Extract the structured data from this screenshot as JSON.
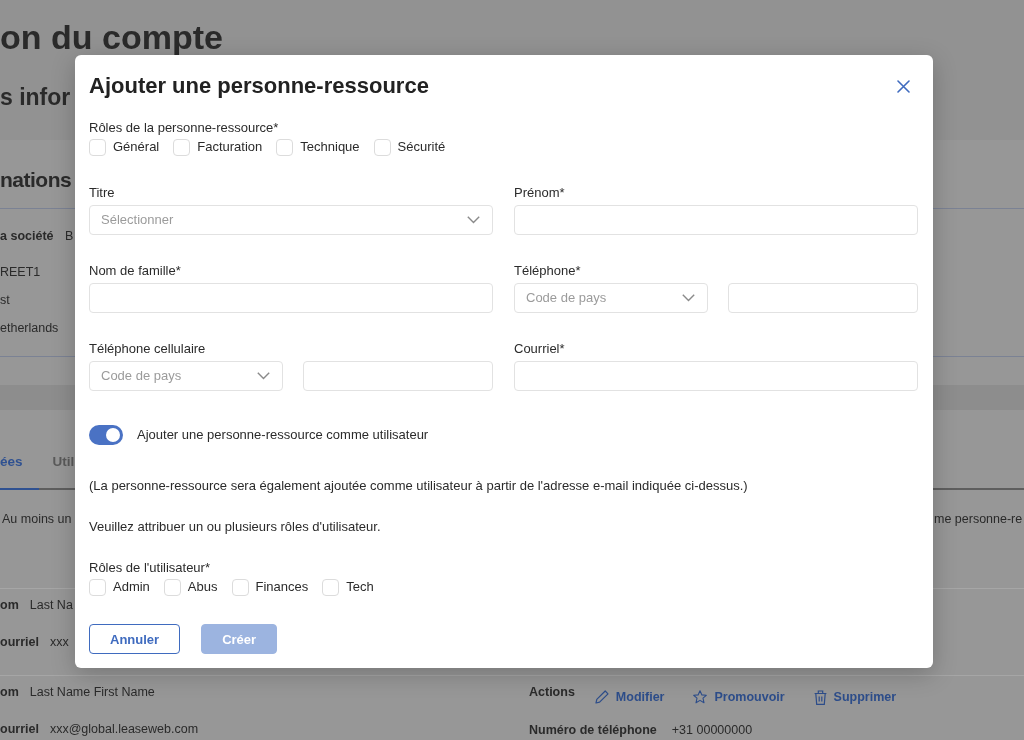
{
  "page": {
    "title": "on du compte",
    "section_title": "s infor",
    "subsection_title": "nations",
    "company": {
      "label": "a société",
      "value": "B"
    },
    "address_lines": [
      "REET1",
      "st",
      "etherlands"
    ],
    "tabs": [
      {
        "label": "ées",
        "selected": true
      },
      {
        "label": "Util",
        "selected": false
      }
    ],
    "notice_left": "Au moins un",
    "notice_right": "me personne-re",
    "contacts": [
      {
        "fields": [
          {
            "label": "om",
            "value": "Last Na"
          },
          {
            "label": "ourriel",
            "value": "xxx"
          }
        ]
      },
      {
        "fields": [
          {
            "label": "om",
            "value": "Last Name First Name"
          },
          {
            "label": "ourriel",
            "value": "xxx@global.leaseweb.com"
          }
        ],
        "actions_label": "Actions",
        "actions": [
          {
            "kind": "edit",
            "label": "Modifier"
          },
          {
            "kind": "promote",
            "label": "Promouvoir"
          },
          {
            "kind": "delete",
            "label": "Supprimer"
          }
        ],
        "phone": {
          "label": "Numéro de téléphone",
          "value": "+31 00000000"
        }
      }
    ]
  },
  "dialog": {
    "title": "Ajouter une personne-ressource",
    "contact_roles": {
      "label": "Rôles de la personne-ressource*",
      "options": [
        {
          "label": "Général",
          "checked": false
        },
        {
          "label": "Facturation",
          "checked": false
        },
        {
          "label": "Technique",
          "checked": false
        },
        {
          "label": "Sécurité",
          "checked": false
        }
      ]
    },
    "fields": [
      {
        "kind": "select",
        "label": "Titre",
        "placeholder": "Sélectionner"
      },
      {
        "kind": "text",
        "label": "Prénom*"
      },
      {
        "kind": "text",
        "label": "Nom de famille*"
      },
      {
        "kind": "phone",
        "label": "Téléphone*",
        "country_code": {
          "placeholder": "Code de pays"
        }
      },
      {
        "kind": "phone",
        "label": "Téléphone cellulaire",
        "country_code": {
          "placeholder": "Code de pays"
        }
      },
      {
        "kind": "text",
        "label": "Courriel*"
      }
    ],
    "add_as_user": {
      "label": "Ajouter une personne-ressource comme utilisateur",
      "on": true
    },
    "note": "(La personne-ressource sera également ajoutée comme utilisateur à partir de l'adresse e-mail indiquée ci-dessus.)",
    "instruction": "Veuillez attribuer un ou plusieurs rôles d'utilisateur.",
    "user_roles": {
      "label": "Rôles de l'utilisateur*",
      "options": [
        {
          "label": "Admin",
          "checked": false
        },
        {
          "label": "Abus",
          "checked": false
        },
        {
          "label": "Finances",
          "checked": false
        },
        {
          "label": "Tech",
          "checked": false
        }
      ]
    },
    "buttons": [
      {
        "kind": "secondary",
        "label": "Annuler",
        "disabled": false
      },
      {
        "kind": "primary",
        "label": "Créer",
        "disabled": true
      }
    ]
  }
}
